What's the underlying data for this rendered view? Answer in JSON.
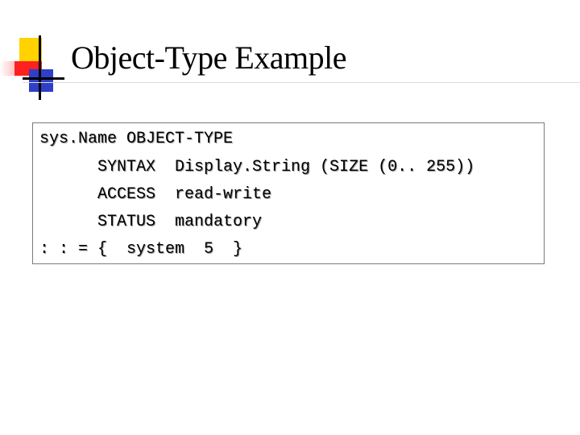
{
  "slide": {
    "title": "Object-Type Example",
    "code_lines": [
      "sys.Name OBJECT-TYPE",
      "      SYNTAX  Display.String (SIZE (0.. 255))",
      "      ACCESS  read-write",
      "      STATUS  mandatory",
      ": : = {  system  5  }"
    ]
  },
  "logo": {
    "icon": "overlapping-squares-logo",
    "colors": [
      "#ffd200",
      "#ff3333",
      "#3344cc",
      "#000000"
    ]
  }
}
